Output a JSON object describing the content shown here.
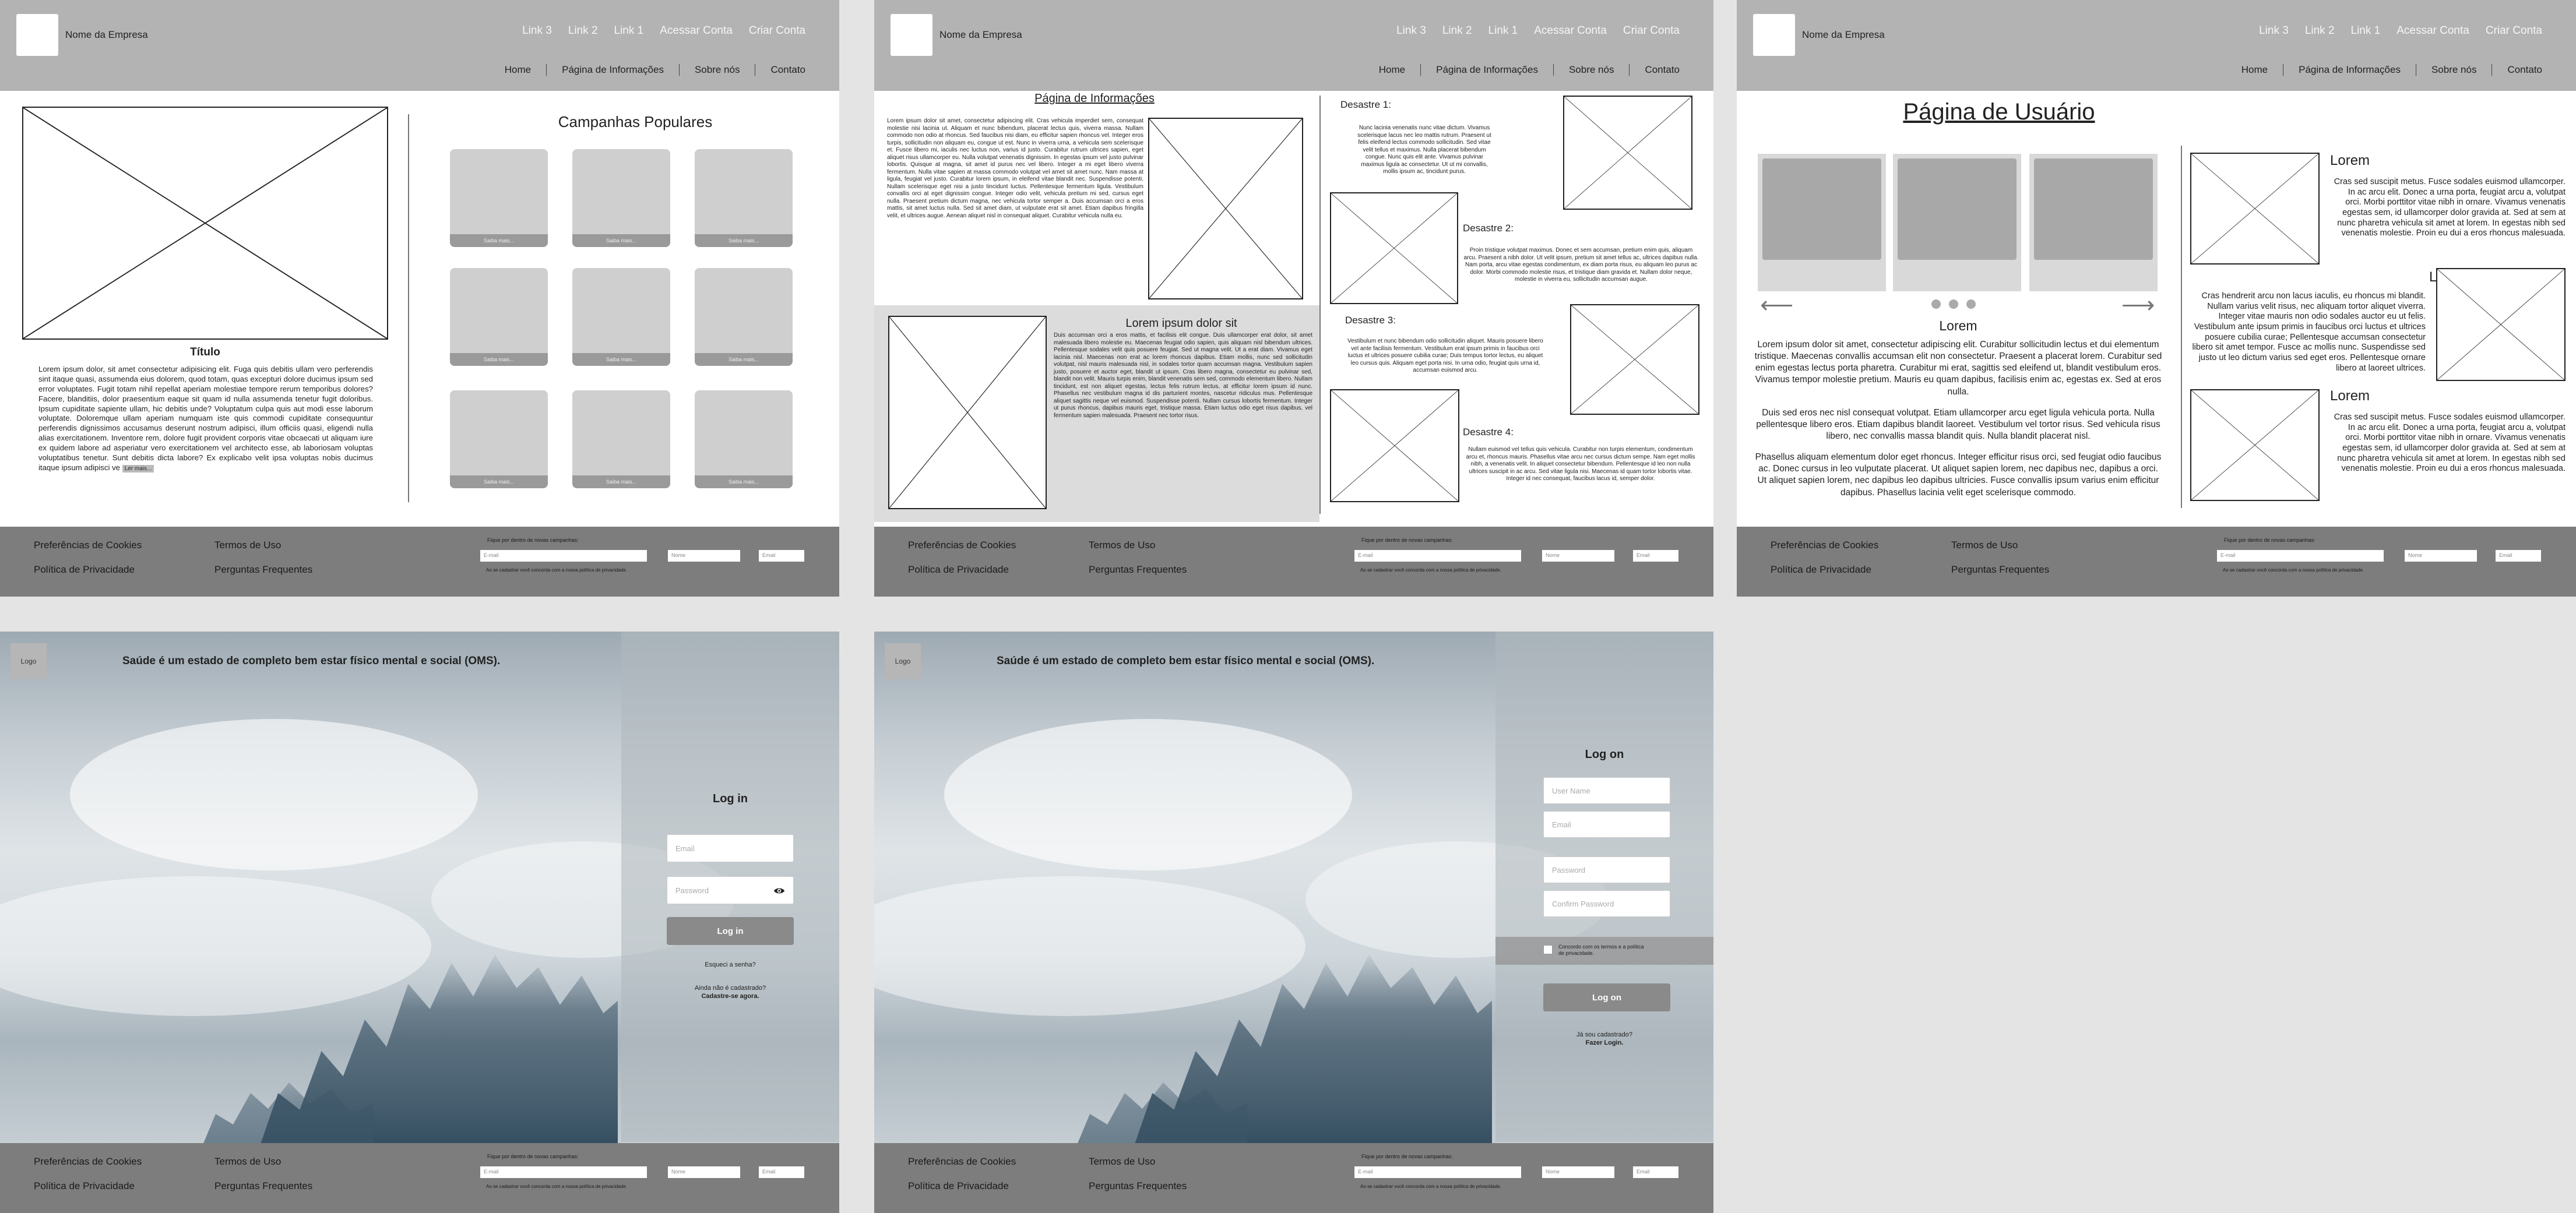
{
  "header": {
    "company": "Nome da Empresa",
    "top_links": [
      "Link 3",
      "Link 2",
      "Link 1",
      "Acessar Conta",
      "Criar Conta"
    ],
    "nav": [
      "Home",
      "Página de Informações",
      "Sobre nós",
      "Contato"
    ]
  },
  "footer": {
    "cookies": "Preferências de Cookies",
    "terms": "Termos de Uso",
    "privacy": "Política de Privacidade",
    "faq": "Perguntas Frequentes",
    "newsletter": "Fique por dentro de novas campanhas:",
    "email_placeholder": "E-mail",
    "name_placeholder": "Nome",
    "email2_placeholder": "Email",
    "consent": "Ao se cadastrar você concorda com a nossa política de privacidade."
  },
  "home": {
    "title": "Título",
    "body": "Lorem ipsum dolor, sit amet consectetur adipisicing elit. Fuga quis debitis ullam vero perferendis sint itaque quasi, assumenda eius dolorem, quod totam, quas excepturi dolore ducimus ipsum sed error voluptates. Fugit totam nihil repellat aperiam molestiae tempore rerum temporibus dolores? Facere, blanditiis, dolor praesentium eaque sit quam id nulla assumenda tenetur fugit doloribus. Ipsum cupiditate sapiente ullam, hic debitis unde? Voluptatum culpa quis aut modi esse laborum voluptate. Doloremque ullam aperiam numquam iste quis commodi cupiditate consequuntur perferendis dignissimos accusamus deserunt nostrum adipisci, illum officiis quasi, eligendi nulla alias exercitationem. Inventore rem, dolore fugit provident corporis vitae obcaecati ut aliquam iure ex quidem labore ad asperiatur vero exercitationem vel architecto esse, ab laboriosam voluptas voluptatibus tenetur. Sunt debitis dicta labore? Ex explicabo velit ipsa voluptas nobis ducimus itaque ipsum adipisci ve",
    "read_more": "Ler mais...",
    "campaigns_title": "Campanhas Populares",
    "card_label": "Saiba mais..."
  },
  "info": {
    "title": "Página de Informações",
    "p1": "Lorem ipsum dolor sit amet, consectetur adipiscing elit. Cras vehicula imperdiet sem, consequat molestie nisi lacinia ut. Aliquam et nunc bibendum, placerat lectus quis, viverra massa. Nullam commodo non odio at rhoncus. Sed faucibus nisi diam, eu efficitur sapien rhoncus vel. Integer eros turpis, sollicitudin non aliquam eu, congue ut est. Nunc in viverra urna, a vehicula sem scelerisque et. Fusce libero mi, iaculis nec luctus non, varius id justo. Curabitur rutrum ultrices sapien, eget aliquet risus ullamcorper eu. Nulla volutpat venenatis dignissim. In egestas ipsum vel justo pulvinar lobortis. Quisque at magna, sit amet id purus nec vel libero. Integer a mi eget libero viverra fermentum. Nulla vitae sapien at massa commodo volutpat vel amet sit amet nunc. Nam massa at ligula, feugiat vel justo. Curabitur lorem ipsum, in eleifend vitae blandit nec. Suspendisse potenti. Nullam scelerisque eget nisi a justo tincidunt luctus. Pellentesque fermentum ligula. Vestibulum convallis orci at eget dignissim congue. Integer odio velit, vehicula pretium mi sed, cursus eget nulla. Praesent pretium dictum magna, nec vehicula tortor semper a. Duis accumsan orci a eros mattis, sit amet luctus nulla. Sed sit amet diam, ut vulputate erat sit amet. Etiam dapibus fringilla velit, et ultrices augue. Aenean aliquet nisl in consequat aliquet. Curabitur vehicula nulla eu.",
    "section_title": "Lorem ipsum dolor sit",
    "p2": "Duis accumsan orci a eros mattis, et facilisis elit congue. Duis ullamcorper erat dolor, sit amet malesuada libero molestie eu. Maecenas feugiat odio sapien, quis aliquam nisl bibendum ultrices. Pellentesque sodales velit quis posuere feugiat. Sed ut magna velit. Ut a erat diam. Vivamus eget lacinia nisl. Maecenas non erat ac lorem rhoncus dapibus. Etiam mollis, nunc sed sollicitudin volutpat, nisl mauris malesuada nisl, in sodales tortor quam accumsan magna. Vestibulum sapien justo, posuere et auctor eget, blandit ut ipsum. Cras libero magna, consectetur eu pulvinar sed, blandit non velit. Mauris turpis enim, blandit venenatis sem sed, commodo elementum libero. Nullam tincidunt, est non aliquet egestas, lectus felis rutrum lectus, at efficitur lorem ipsum id nunc. Phasellus nec vestibulum magna id dis parturient montes, nascetur ridiculus mus. Pellentesque aliquet sagittis neque vel euismod. Suspendisse potenti. Nullam cursus lobortis fermentum. Integer ut purus rhoncus, dapibus mauris eget, tristique massa. Etiam luctus odio eget risus dapibus, vel fermentum sapien malesuada. Praesent nec tortor risus.",
    "d1": "Desastre 1:",
    "d1_text": "Nunc lacinia venenatis nunc vitae dictum. Vivamus scelerisque lacus nec leo mattis rutrum. Praesent ut felis eleifend lectus commodo sollicitudin. Sed vitae velit tellus et maximus. Nulla placerat bibendum congue. Nunc quis elit ante. Vivamus pulvinar maximus ligula ac consectetur. Ut ut mi convallis, mollis ipsum ac, tincidunt purus.",
    "d2": "Desastre 2:",
    "d2_text": "Proin tristique volutpat maximus. Donec et sem accumsan, pretium enim quis, aliquam arcu. Praesent a nibh dolor. Ut velit ipsum, pretium sit amet tellus ac, ultrices dapibus nulla. Nam porta, arcu vitae egestas condimentum, ex diam porta risus, eu aliquam leo purus ac dolor. Morbi commodo molestie risus, et tristique diam gravida et. Nullam dolor neque, molestie in viverra eu, sollicitudin accumsan augue.",
    "d3": "Desastre 3:",
    "d3_text": "Vestibulum et nunc bibendum odio sollicitudin aliquet. Mauris posuere libero vel ante facilisis fermentum. Vestibulum erat ipsum primis in faucibus orci luctus et ultrices posuere cubilia curae; Duis tempus tortor lectus, eu aliquet leo cursus quis. Aliquam eget porta nisi. In urna odio, feugiat quis urna id, accumsan euismod arcu.",
    "d4": "Desastre 4:",
    "d4_text": "Nullam euismod vel tellus quis vehicula. Curabitur non turpis elementum, condimentum arcu et, rhoncus mauris. Phasellus vitae arcu nec cursus dictum sempe. Nam eget mollis nibh, a venenatis velit. In aliquet consectetur bibendum. Pellentesque id leo non nulla ultrices suscipit in ac arcu. Sed vitae ligula nisi. Maecenas id quam tortor lobortis vitae. Integer id nec consequat, faucibus lacus id, semper dolor."
  },
  "user": {
    "title": "Página de Usuário",
    "caption": "Lorem",
    "p1": "Lorem ipsum dolor sit amet, consectetur adipiscing elit. Curabitur sollicitudin lectus et dui elementum tristique. Maecenas convallis accumsan elit non consectetur. Praesent a placerat lorem. Curabitur sed enim egestas lectus porta pharetra. Curabitur mi erat, sagittis sed eleifend ut, blandit vestibulum eros. Vivamus tempor molestie pretium. Mauris eu quam dapibus, facilisis enim ac, egestas ex. Sed at eros nulla.",
    "p2": "Duis sed eros nec nisl consequat volutpat. Etiam ullamcorper arcu eget ligula vehicula porta. Nulla pellentesque libero eros. Etiam dapibus blandit laoreet. Vestibulum vel tortor risus. Sed vehicula risus libero, nec convallis massa blandit quis. Nulla blandit placerat nisl.",
    "p3": "Phasellus aliquam elementum dolor eget rhoncus. Integer efficitur risus orci, sed feugiat odio faucibus ac. Donec cursus in leo vulputate placerat. Ut aliquet sapien lorem, nec dapibus nec, dapibus a orci. Ut aliquet sapien lorem, nec dapibus leo dapibus ultricies. Fusce convallis ipsum varius enim efficitur dapibus. Phasellus lacinia velit eget scelerisque commodo.",
    "s1_title": "Lorem",
    "s1": "Cras sed suscipit metus. Fusce sodales euismod ullamcorper. In ac arcu elit. Donec a urna porta, feugiat arcu a, volutpat orci. Morbi porttitor vitae nibh in ornare. Vivamus venenatis egestas sem, id ullamcorper dolor gravida at. Sed at sem at nunc pharetra vehicula sit amet at lorem. In egestas nibh sed venenatis molestie. Proin eu dui a eros rhoncus malesuada.",
    "s2_title": "Lorem",
    "s2": "Cras hendrerit arcu non lacus iaculis, eu rhoncus mi blandit. Nullam varius velit risus, nec aliquam tortor aliquet viverra. Integer vitae mauris non odio sodales auctor eu ut felis. Vestibulum ante ipsum primis in faucibus orci luctus et ultrices posuere cubilia curae; Pellentesque accumsan consectetur libero sit amet tempor. Fusce ac mollis nunc. Suspendisse sed justo ut leo dictum varius sed eget eros. Pellentesque ornare libero at laoreet ultrices.",
    "s3_title": "Lorem",
    "s3": "Cras sed suscipit metus. Fusce sodales euismod ullamcorper. In ac arcu elit. Donec a urna porta, feugiat arcu a, volutpat orci. Morbi porttitor vitae nibh in ornare. Vivamus venenatis egestas sem, id ullamcorper dolor gravida at. Sed at sem at nunc pharetra vehicula sit amet at lorem. In egestas nibh sed venenatis molestie. Proin eu dui a eros rhoncus malesuada."
  },
  "auth": {
    "logo": "Logo",
    "quote": "Saúde é um estado de completo bem estar físico mental e social (OMS).",
    "login_title": "Log in",
    "email": "Email",
    "password": "Password",
    "login_button": "Log in",
    "forgot": "Esqueci a senha?",
    "no_account": "Ainda não é cadastrado?",
    "signup_link": "Cadastre-se agora.",
    "signup_title": "Log on",
    "username": "User Name",
    "confirm": "Confirm Password",
    "agree": "Concordo com os termos e a política de privacidade.",
    "signup_button": "Log on",
    "have_account": "Já sou cadastrado?",
    "login_link": "Fazer Login."
  }
}
